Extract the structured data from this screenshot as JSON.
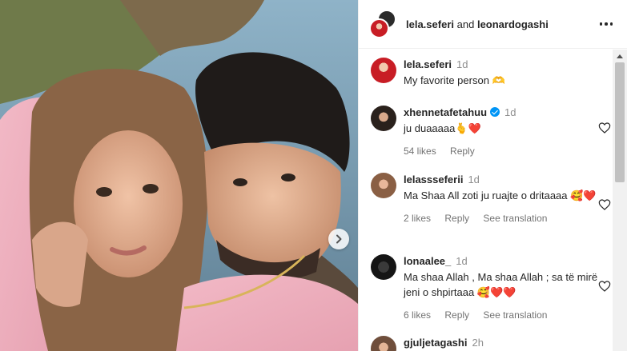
{
  "header": {
    "user1": "lela.seferi",
    "joiner": "and",
    "user2": "leonardogashi",
    "more_icon": "more-horizontal-icon"
  },
  "photo": {
    "next_icon": "chevron-right-icon"
  },
  "comments": [
    {
      "username": "lela.seferi",
      "time": "1d",
      "text": "My favorite person 🫶",
      "verified": false
    },
    {
      "username": "xhennetafetahuu",
      "time": "1d",
      "text": "ju duaaaaa🫰❤️",
      "verified": true,
      "likes": "54 likes",
      "reply": "Reply"
    },
    {
      "username": "lelassseferii",
      "time": "1d",
      "text": "Ma Shaa All zoti ju ruajte o dritaaaa 🥰❤️",
      "likes": "2 likes",
      "reply": "Reply",
      "translation": "See translation"
    },
    {
      "username": "lonaalee_",
      "time": "1d",
      "text": "Ma shaa Allah , Ma shaa Allah ; sa të mirë jeni o shpirtaaa 🥰❤️❤️",
      "likes": "6 likes",
      "reply": "Reply",
      "translation": "See translation"
    },
    {
      "username": "gjuljetagashi",
      "time": "2h"
    }
  ],
  "colors": {
    "accent": "#0095f6",
    "text": "#262626",
    "muted": "#737373",
    "heart": "#d6203a"
  }
}
